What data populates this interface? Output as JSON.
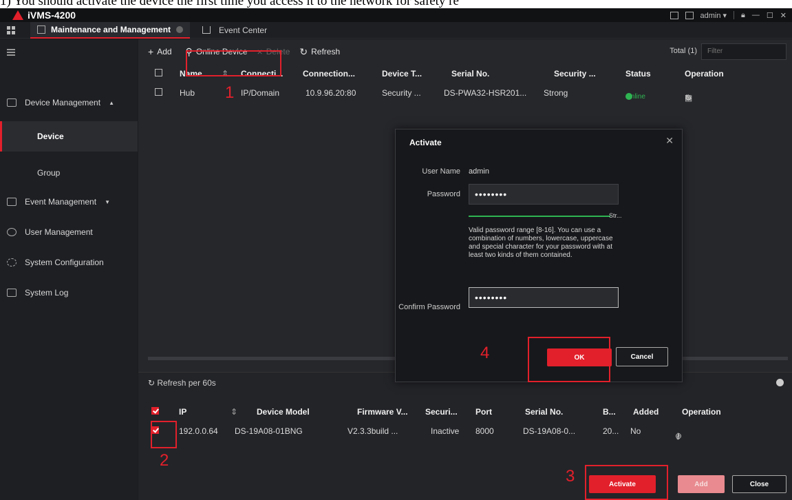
{
  "caption": "1)   You should activate the device the first time you access it to the network for safety re",
  "app": {
    "title": "iVMS-4200",
    "user": "admin"
  },
  "tabs": [
    {
      "label": "Maintenance and Management"
    },
    {
      "label": "Event Center"
    }
  ],
  "sidebar": {
    "items": [
      {
        "label": "Device Management"
      },
      {
        "label": "Device"
      },
      {
        "label": "Group"
      },
      {
        "label": "Event Management"
      },
      {
        "label": "User Management"
      },
      {
        "label": "System Configuration"
      },
      {
        "label": "System Log"
      }
    ]
  },
  "toolbar": {
    "add": "Add",
    "online_device": "Online Device",
    "delete": "Delete",
    "refresh": "Refresh",
    "total": "Total (1)",
    "filter_placeholder": "Filter"
  },
  "device_table": {
    "headers": [
      "Name",
      "Connecti...",
      "Connection...",
      "Device T...",
      "Serial No.",
      "Security ...",
      "Status",
      "Operation"
    ],
    "rows": [
      {
        "name": "Hub",
        "conn_type": "IP/Domain",
        "connection": "10.9.96.20:80",
        "device_type": "Security ...",
        "serial": "DS-PWA32-HSR201...",
        "security": "Strong",
        "status": "Online"
      }
    ]
  },
  "online_area": {
    "refresh_label": "Refresh per 60s",
    "headers": [
      "IP",
      "Device Model",
      "Firmware V...",
      "Securi...",
      "Port",
      "Serial No.",
      "B...",
      "Added",
      "Operation"
    ],
    "rows": [
      {
        "ip": "192.0.0.64",
        "model": "DS-19A08-01BNG",
        "firmware": "V2.3.3build ...",
        "security": "Inactive",
        "port": "8000",
        "serial": "DS-19A08-0...",
        "boot": "20...",
        "added": "No"
      }
    ],
    "buttons": {
      "activate": "Activate",
      "add": "Add",
      "close": "Close"
    }
  },
  "dialog": {
    "title": "Activate",
    "user_name_label": "User Name",
    "user_name": "admin",
    "password_label": "Password",
    "password_value": "••••••••",
    "strength_label": "Str...",
    "hint": "Valid password range [8-16]. You can use a combination of numbers, lowercase, uppercase and special character for your password with at least two kinds of them contained.",
    "confirm_label": "Confirm Password",
    "confirm_value": "••••••••",
    "ok": "OK",
    "cancel": "Cancel"
  },
  "annotations": {
    "step1": "1",
    "step2": "2",
    "step3": "3",
    "step4": "4"
  },
  "colors": {
    "accent": "#e2202b",
    "online": "#2fb552",
    "background": "#1b1c1f"
  }
}
